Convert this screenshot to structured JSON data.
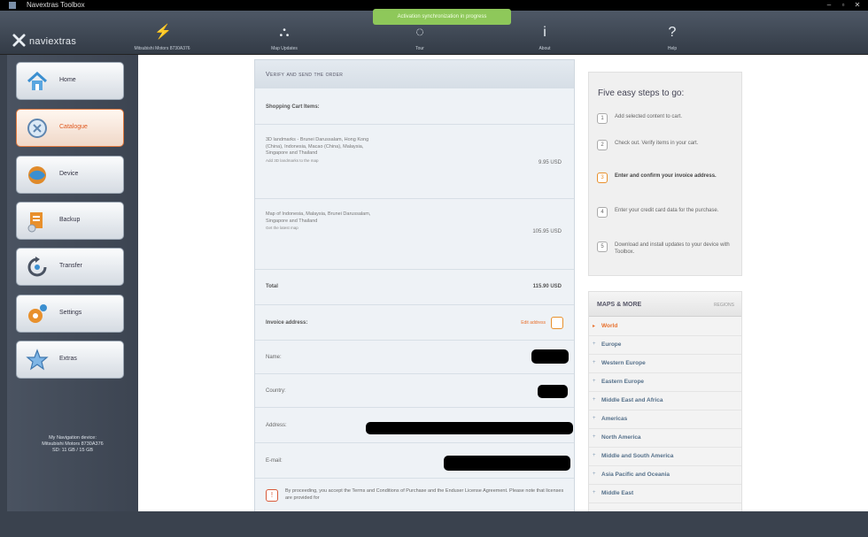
{
  "window": {
    "title": "Navextras Toolbox"
  },
  "notice": {
    "text": "Activation synchronization in progress"
  },
  "app": {
    "logo": "naviextras"
  },
  "top_tabs": [
    {
      "label": "Mitsubishi Motors 8730A376",
      "icon": "device-connect-icon"
    },
    {
      "label": "Map Updates",
      "icon": "map-updates-icon"
    },
    {
      "label": "Tour",
      "icon": "tour-icon"
    },
    {
      "label": "About",
      "icon": "info-icon"
    },
    {
      "label": "Help",
      "icon": "help-icon"
    }
  ],
  "sidebar": {
    "items": [
      {
        "label": "Home",
        "icon": "home-icon",
        "active": false
      },
      {
        "label": "Catalogue",
        "icon": "catalogue-icon",
        "active": true
      },
      {
        "label": "Device",
        "icon": "device-icon",
        "active": false
      },
      {
        "label": "Backup",
        "icon": "backup-icon",
        "active": false
      },
      {
        "label": "Transfer",
        "icon": "transfer-icon",
        "active": false
      },
      {
        "label": "Settings",
        "icon": "settings-icon",
        "active": false
      },
      {
        "label": "Extras",
        "icon": "extras-icon",
        "active": false
      }
    ],
    "device_info": {
      "line1": "My Navigation device:",
      "line2": "Mitsubishi Motors 8730A376",
      "line3": "SD: 11 GB / 15 GB"
    }
  },
  "order": {
    "heading": "Verify and send the order",
    "cart_label": "Shopping Cart Items:",
    "items": [
      {
        "desc": "3D landmarks - Brunei Darussalam, Hong Kong (China), Indonesia, Macao (China), Malaysia, Singapore and Thailand",
        "sub": "Add 3D landmarks to the map",
        "price": "9.95 USD"
      },
      {
        "desc": "Map of Indonesia, Malaysia, Brunei Darussalam, Singapore and Thailand",
        "sub": "Get the latest map",
        "price": "105.95 USD"
      }
    ],
    "total_label": "Total",
    "total_value": "115.90 USD",
    "invoice_label": "Invoice address:",
    "edit_address": "Edit address",
    "fields": {
      "name": "Name:",
      "country": "Country:",
      "address": "Address:",
      "email": "E-mail:"
    },
    "terms": "By proceeding, you accept the Terms and Conditions of Purchase and the Enduser License Agreement. Please note that licenses are provided for"
  },
  "steps": {
    "title": "Five easy steps to go:",
    "items": [
      {
        "num": "1",
        "text": "Add selected content to cart."
      },
      {
        "num": "2",
        "text": "Check out. Verify items in your cart."
      },
      {
        "num": "3",
        "text": "Enter and confirm your invoice address."
      },
      {
        "num": "4",
        "text": "Enter your credit card data for the purchase."
      },
      {
        "num": "5",
        "text": "Download and install updates to your device with Toolbox."
      }
    ],
    "active_index": 2
  },
  "maps_more": {
    "title": "MAPS & MORE",
    "right": "REGIONS",
    "regions": [
      "World",
      "Europe",
      "Western Europe",
      "Eastern Europe",
      "Middle East and Africa",
      "Americas",
      "North America",
      "Middle and South America",
      "Asia Pacific and Oceania",
      "Middle East"
    ],
    "selected_index": 0
  },
  "colors": {
    "accent": "#e8702c",
    "notice": "#8ec85a",
    "topbar": "#3d4553",
    "sidebar": "#444c59"
  }
}
